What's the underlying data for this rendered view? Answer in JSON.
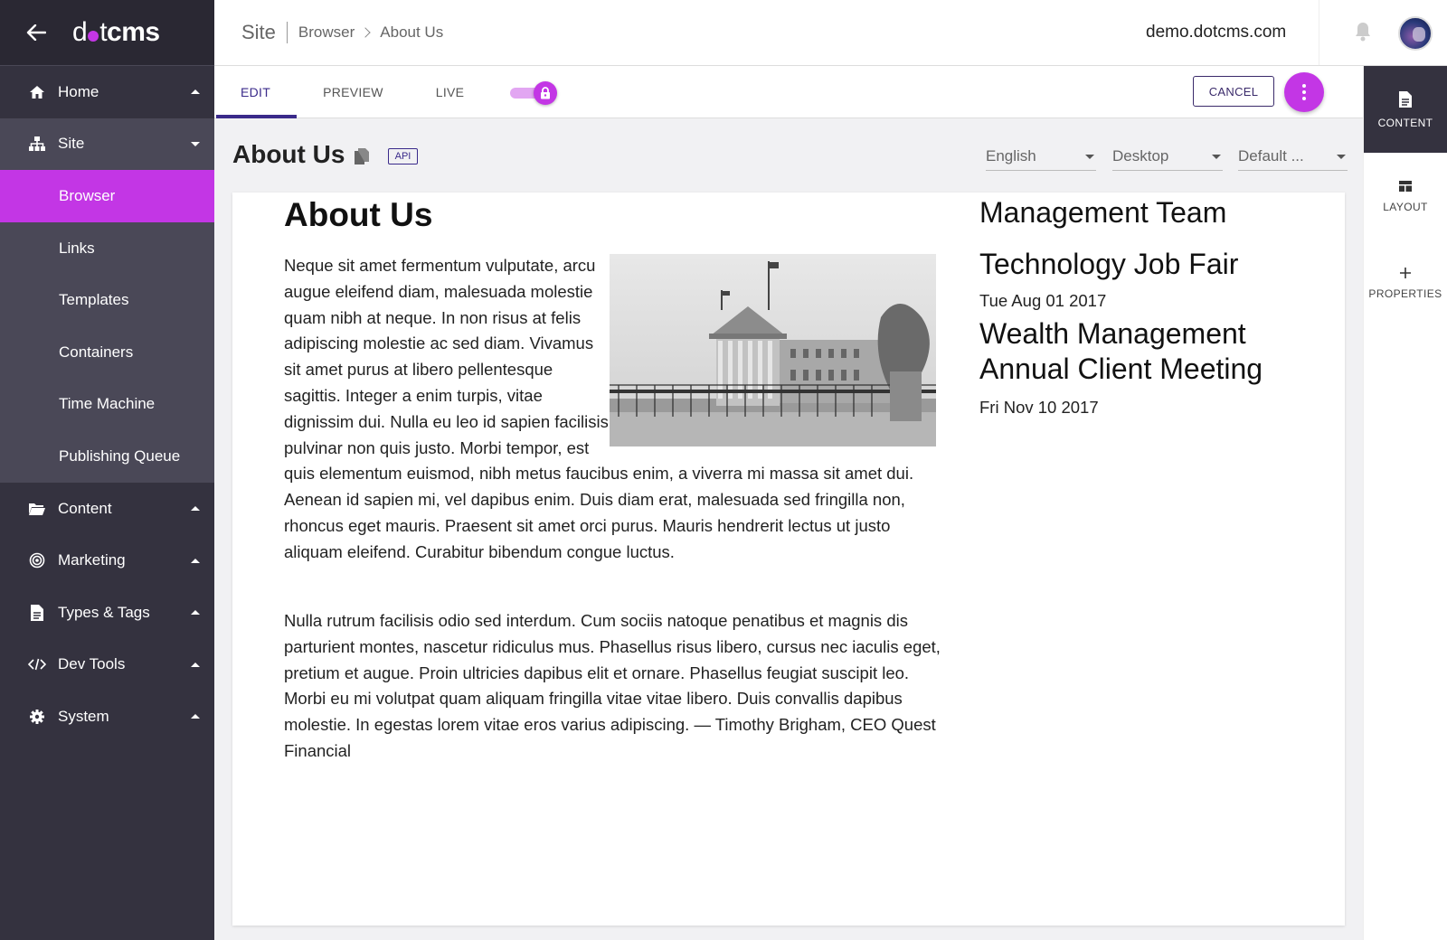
{
  "app": {
    "logo": {
      "prefix": "d",
      "suffix_dot": "t",
      "cms": "cms"
    },
    "accent": "#c336e5",
    "sidebar_bg": "#34323f"
  },
  "sidebar": {
    "sections": [
      {
        "label": "Home",
        "icon": "home-icon",
        "state": "collapsed"
      },
      {
        "label": "Site",
        "icon": "sitemap-icon",
        "state": "open",
        "items": [
          {
            "label": "Browser",
            "active": true
          },
          {
            "label": "Links"
          },
          {
            "label": "Templates"
          },
          {
            "label": "Containers"
          },
          {
            "label": "Time Machine"
          },
          {
            "label": "Publishing Queue"
          }
        ]
      },
      {
        "label": "Content",
        "icon": "folder-icon",
        "state": "collapsed"
      },
      {
        "label": "Marketing",
        "icon": "target-icon",
        "state": "collapsed"
      },
      {
        "label": "Types & Tags",
        "icon": "document-icon",
        "state": "collapsed"
      },
      {
        "label": "Dev Tools",
        "icon": "code-icon",
        "state": "collapsed"
      },
      {
        "label": "System",
        "icon": "gear-icon",
        "state": "collapsed"
      }
    ]
  },
  "topbar": {
    "breadcrumb": {
      "root": "Site",
      "items": [
        "Browser",
        "About Us"
      ]
    },
    "host": "demo.dotcms.com"
  },
  "toolbar": {
    "tabs": [
      "EDIT",
      "PREVIEW",
      "LIVE"
    ],
    "active_tab": "EDIT",
    "cancel_label": "CANCEL"
  },
  "rail": {
    "items": [
      {
        "label": "CONTENT",
        "icon": "file-icon",
        "active": true
      },
      {
        "label": "LAYOUT",
        "icon": "layout-icon"
      },
      {
        "label": "PROPERTIES",
        "icon": "plus-icon"
      }
    ]
  },
  "page": {
    "title": "About Us",
    "api_label": "API",
    "language": "English",
    "device": "Desktop",
    "persona": "Default ..."
  },
  "content": {
    "heading": "About Us",
    "paragraph1": "Neque sit amet fermentum vulputate, arcu augue eleifend diam, malesuada molestie quam nibh at neque. In non risus at felis adipiscing molestie ac sed diam. Vivamus sit amet purus at libero pellentesque sagittis. Integer a enim turpis, vitae dignissim dui. Nulla eu leo id sapien facilisis pulvinar non quis justo. Morbi tempor, est quis elementum euismod, nibh metus faucibus enim, a viverra mi massa sit amet dui. Aenean id sapien mi, vel dapibus enim. Duis diam erat, malesuada sed fringilla non, rhoncus eget mauris. Praesent sit amet orci purus. Mauris hendrerit lectus ut justo aliquam eleifend. Curabitur bibendum congue luctus.",
    "paragraph2": "Nulla rutrum facilisis odio sed interdum. Cum sociis natoque penatibus et magnis dis parturient montes, nascetur ridiculus mus. Phasellus risus libero, cursus nec iaculis eget, pretium et augue. Proin ultricies dapibus elit et ornare. Phasellus feugiat suscipit leo. Morbi eu mi volutpat quam aliquam fringilla vitae vitae libero. Duis convallis dapibus molestie. In egestas lorem vitae eros varius adipiscing. — Timothy Brigham, CEO Quest Financial",
    "right": {
      "team_heading": "Management Team",
      "events": [
        {
          "title": "Technology Job Fair",
          "date": "Tue Aug 01 2017"
        },
        {
          "title": "Wealth Management Annual Client Meeting",
          "date": "Fri Nov 10 2017"
        }
      ]
    }
  }
}
